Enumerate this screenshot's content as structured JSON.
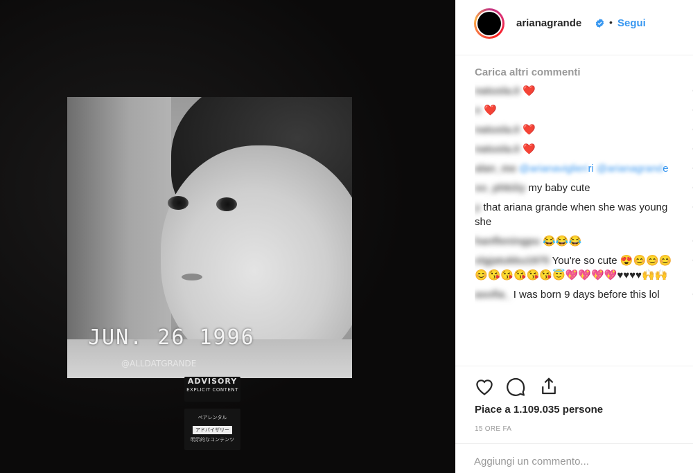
{
  "media": {
    "date_stamp": "JUN. 26 1996",
    "watermark_handle": "@ALLDATGRANDE",
    "advisory": {
      "line1": "ADVISORY",
      "line2": "EXPLICIT CONTENT"
    },
    "advisory_jp": {
      "line1": "ペアレンタル",
      "line2": "アドバイザリー",
      "line3": "明示的なコンテンツ"
    }
  },
  "header": {
    "username": "arianagrande",
    "verified": true,
    "separator": "•",
    "follow_label": "Segui"
  },
  "comments": {
    "load_more": "Carica altri commenti",
    "items": [
      {
        "user": "natusla.0",
        "text": "",
        "emoji": "❤️"
      },
      {
        "user": "n",
        "text": "",
        "emoji": "❤️"
      },
      {
        "user": "natusla.0",
        "text": "",
        "emoji": "❤️"
      },
      {
        "user": "natusla.0",
        "text": "",
        "emoji": "❤️"
      },
      {
        "user": "alan_me",
        "tag1": "@arianaviglieri",
        "tag2": "@arianagrand",
        "tag_tail": "ri",
        "tag_tail2": "e"
      },
      {
        "user": "so_phkiiiy",
        "text": "my baby cute"
      },
      {
        "user": "y",
        "text": "that ariana grande when she was young she"
      },
      {
        "user": "hanfleningpu",
        "text": "",
        "emoji": "😂😂😂"
      },
      {
        "user": "slgjatukku1975",
        "text": "You're so cute",
        "emoji": "😍😊😊😊😊😘😘😘😘😘😇💖💖💖💖♥♥♥♥🙌🙌"
      },
      {
        "user": "asofia_",
        "text": "I was born 9 days before this lol"
      }
    ]
  },
  "actions": {
    "like_icon": "heart-icon",
    "comment_icon": "comment-icon",
    "share_icon": "share-icon",
    "likes_text": "Piace a 1.109.035 persone",
    "time_text": "15 ORE FA"
  },
  "add_comment": {
    "placeholder": "Aggiungi un commento..."
  },
  "colors": {
    "link_blue": "#3897f0",
    "heart_red": "#ed4956",
    "muted": "#999999",
    "text": "#262626"
  }
}
